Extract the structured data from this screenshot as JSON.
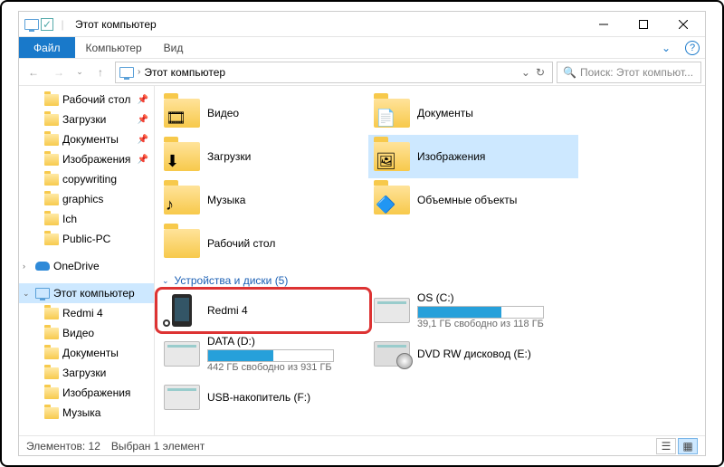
{
  "title": "Этот компьютер",
  "ribbon": {
    "file": "Файл",
    "tabs": [
      "Компьютер",
      "Вид"
    ]
  },
  "breadcrumb": {
    "item": "Этот компьютер"
  },
  "search": {
    "placeholder": "Поиск: Этот компьют..."
  },
  "nav": {
    "quick": [
      {
        "label": "Рабочий стол",
        "pinned": true
      },
      {
        "label": "Загрузки",
        "pinned": true
      },
      {
        "label": "Документы",
        "pinned": true
      },
      {
        "label": "Изображения",
        "pinned": true
      },
      {
        "label": "copywriting",
        "pinned": false
      },
      {
        "label": "graphics",
        "pinned": false
      },
      {
        "label": "Ich",
        "pinned": false
      },
      {
        "label": "Public-PC",
        "pinned": false
      }
    ],
    "onedrive": "OneDrive",
    "thispc": "Этот компьютер",
    "thispc_children": [
      "Redmi 4",
      "Видео",
      "Документы",
      "Загрузки",
      "Изображения",
      "Музыка"
    ]
  },
  "folders_group": {
    "visible_items": [
      {
        "label": "Видео",
        "icon": "film"
      },
      {
        "label": "Документы",
        "icon": "doc"
      },
      {
        "label": "Загрузки",
        "icon": "down"
      },
      {
        "label": "Изображения",
        "icon": "pic",
        "selected": true
      },
      {
        "label": "Музыка",
        "icon": "music"
      },
      {
        "label": "Объемные объекты",
        "icon": "cube"
      },
      {
        "label": "Рабочий стол",
        "icon": ""
      }
    ]
  },
  "devices_group": {
    "header": "Устройства и диски (5)",
    "items": [
      {
        "label": "Redmi 4",
        "type": "phone"
      },
      {
        "label": "OS (C:)",
        "type": "disk",
        "sub": "39,1 ГБ свободно из 118 ГБ",
        "fill": 67
      },
      {
        "label": "DATA (D:)",
        "type": "disk",
        "sub": "442 ГБ свободно из 931 ГБ",
        "fill": 52
      },
      {
        "label": "DVD RW дисковод (E:)",
        "type": "dvd"
      },
      {
        "label": "USB-накопитель (F:)",
        "type": "usb"
      }
    ]
  },
  "status": {
    "count": "Элементов: 12",
    "sel": "Выбран 1 элемент"
  }
}
